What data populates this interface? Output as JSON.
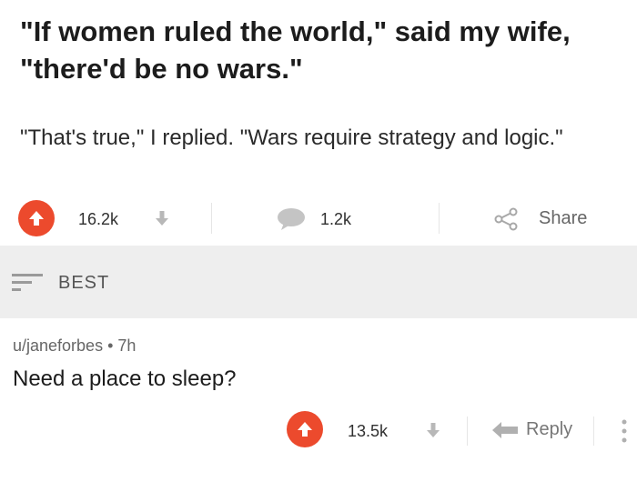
{
  "post": {
    "title": "\"If women ruled the world,\" said my wife, \"there'd be no wars.\"",
    "body": "\"That's true,\" I replied. \"Wars require strategy and logic.\"",
    "upvotes": "16.2k",
    "comments": "1.2k",
    "share_label": "Share"
  },
  "sort": {
    "label": "BEST"
  },
  "comment": {
    "author": "u/janeforbes",
    "separator": "•",
    "age": "7h",
    "text": "Need a place to sleep?",
    "upvotes": "13.5k",
    "reply_label": "Reply"
  },
  "colors": {
    "upvote": "#ec4a2d",
    "section_bg": "#eeeeee"
  }
}
